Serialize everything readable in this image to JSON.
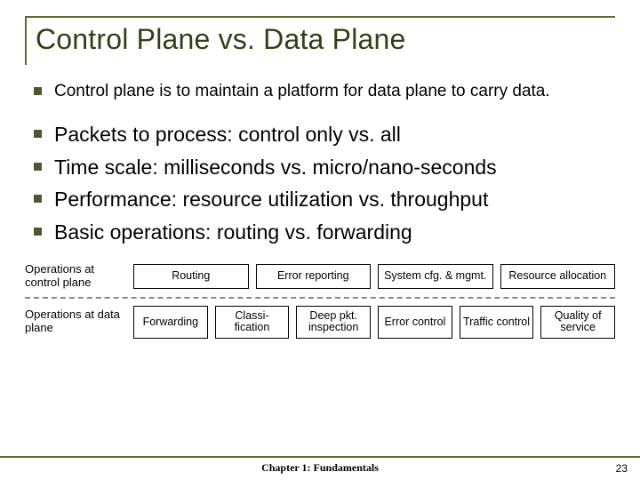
{
  "title": "Control Plane vs. Data Plane",
  "bullets": {
    "b0": "Control plane is to maintain a platform for data plane to carry data.",
    "b1": "Packets to process: control only vs. all",
    "b2": "Time scale: milliseconds vs. micro/nano-seconds",
    "b3": "Performance: resource utilization vs. throughput",
    "b4": "Basic operations: routing vs. forwarding"
  },
  "ops": {
    "control_label": "Operations at control plane",
    "data_label": "Operations at data plane",
    "control_boxes": {
      "c0": "Routing",
      "c1": "Error reporting",
      "c2": "System cfg. & mgmt.",
      "c3": "Resource allocation"
    },
    "data_boxes": {
      "d0": "Forwarding",
      "d1": "Classi-\nfication",
      "d2": "Deep pkt. inspection",
      "d3": "Error control",
      "d4": "Traffic control",
      "d5": "Quality of service"
    }
  },
  "footer": {
    "chapter": "Chapter 1: Fundamentals",
    "page": "23"
  }
}
